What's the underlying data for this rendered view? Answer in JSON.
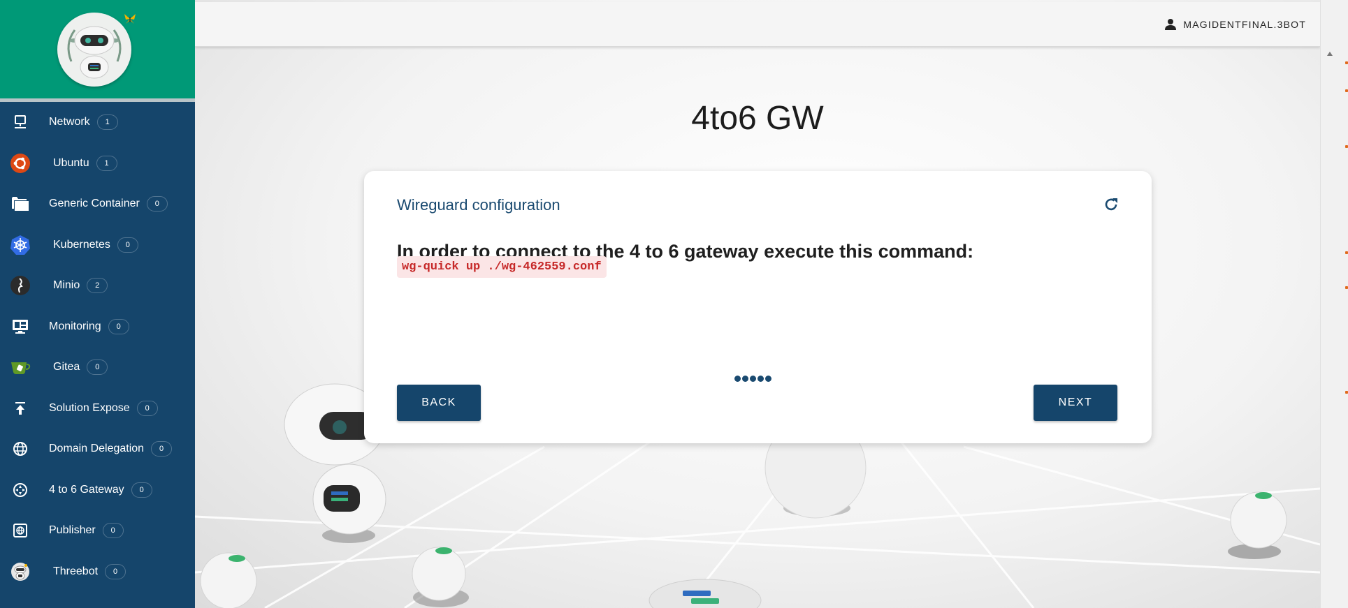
{
  "sidebar": {
    "items": [
      {
        "label": "Network",
        "count": "1",
        "icon": "monitor-network-icon"
      },
      {
        "label": "Ubuntu",
        "count": "1",
        "icon": "ubuntu-icon"
      },
      {
        "label": "Generic Container",
        "count": "0",
        "icon": "folder-icon"
      },
      {
        "label": "Kubernetes",
        "count": "0",
        "icon": "kubernetes-icon"
      },
      {
        "label": "Minio",
        "count": "2",
        "icon": "minio-icon"
      },
      {
        "label": "Monitoring",
        "count": "0",
        "icon": "monitor-dashboard-icon"
      },
      {
        "label": "Gitea",
        "count": "0",
        "icon": "gitea-icon"
      },
      {
        "label": "Solution Expose",
        "count": "0",
        "icon": "upload-icon"
      },
      {
        "label": "Domain Delegation",
        "count": "0",
        "icon": "globe-icon"
      },
      {
        "label": "4 to 6 Gateway",
        "count": "0",
        "icon": "gateway-icon"
      },
      {
        "label": "Publisher",
        "count": "0",
        "icon": "web-icon"
      },
      {
        "label": "Threebot",
        "count": "0",
        "icon": "threebot-icon"
      }
    ]
  },
  "header": {
    "user": "MAGIDENTFINAL.3BOT"
  },
  "main": {
    "title": "4to6 GW",
    "card": {
      "title": "Wireguard configuration",
      "instruction": "In order to connect to the 4 to 6 gateway execute this command:",
      "command": "wg-quick up ./wg-462559.conf",
      "back_label": "BACK",
      "next_label": "NEXT",
      "steps": 5
    }
  },
  "colors": {
    "sidebar": "#15456b",
    "logo_bg": "#009977",
    "accent": "#1a4a70",
    "command_text": "#c62828",
    "command_bg": "#fbe5e6"
  }
}
